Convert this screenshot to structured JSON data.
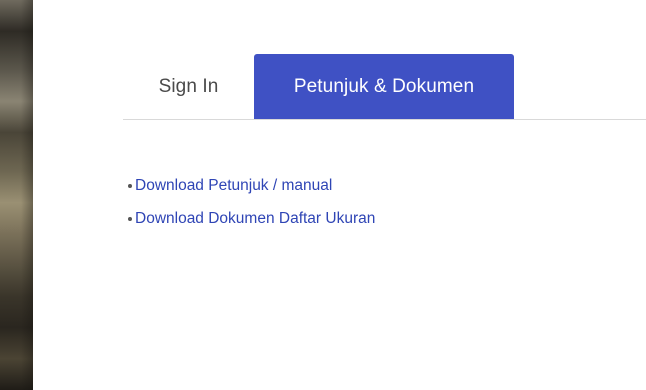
{
  "tabs": {
    "sign_in": "Sign In",
    "docs": "Petunjuk & Dokumen"
  },
  "documents": {
    "items": [
      {
        "label": "Download Petunjuk / manual"
      },
      {
        "label": "Download Dokumen Daftar Ukuran"
      }
    ]
  },
  "colors": {
    "accent": "#3f51c4",
    "link": "#2f45b5"
  }
}
